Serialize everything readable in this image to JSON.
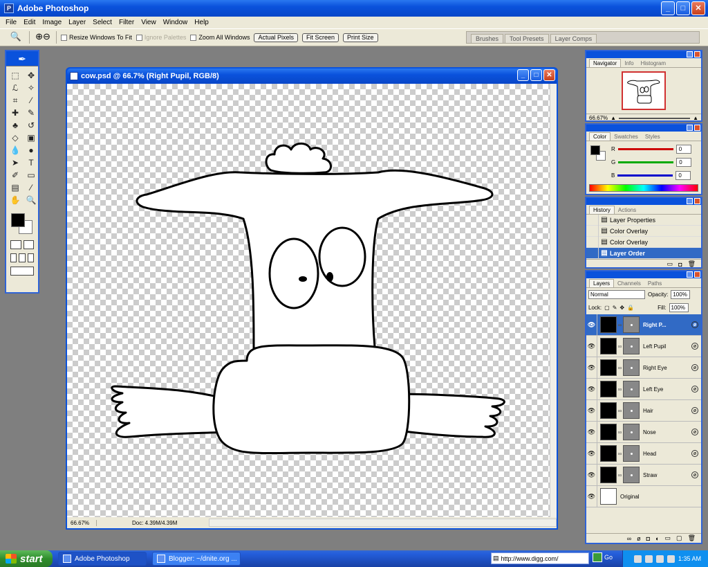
{
  "app": {
    "title": "Adobe Photoshop"
  },
  "window_buttons": {
    "minimize": "_",
    "maximize": "□",
    "close": "✕"
  },
  "menu": [
    "File",
    "Edit",
    "Image",
    "Layer",
    "Select",
    "Filter",
    "View",
    "Window",
    "Help"
  ],
  "options_bar": {
    "resize_windows": "Resize Windows To Fit",
    "ignore_palettes": "Ignore Palettes",
    "zoom_all": "Zoom All Windows",
    "actual_pixels": "Actual Pixels",
    "fit_screen": "Fit Screen",
    "print_size": "Print Size",
    "palette_well": [
      "Brushes",
      "Tool Presets",
      "Layer Comps"
    ]
  },
  "document": {
    "title": "cow.psd @ 66.7% (Right Pupil, RGB/8)",
    "status_zoom": "66.67%",
    "status_doc": "Doc: 4.39M/4.39M"
  },
  "navigator": {
    "tabs": [
      "Navigator",
      "Info",
      "Histogram"
    ],
    "zoom": "66.67%"
  },
  "color": {
    "tabs": [
      "Color",
      "Swatches",
      "Styles"
    ],
    "r_label": "R",
    "g_label": "G",
    "b_label": "B",
    "r": "0",
    "g": "0",
    "b": "0"
  },
  "history": {
    "tabs": [
      "History",
      "Actions"
    ],
    "items": [
      "Layer Properties",
      "Color Overlay",
      "Color Overlay",
      "Layer Order"
    ]
  },
  "layers": {
    "tabs": [
      "Layers",
      "Channels",
      "Paths"
    ],
    "blend_mode": "Normal",
    "opacity_label": "Opacity:",
    "opacity": "100%",
    "lock_label": "Lock:",
    "fill_label": "Fill:",
    "fill": "100%",
    "items": [
      "Right P...",
      "Left Pupil",
      "Right Eye",
      "Left Eye",
      "Hair",
      "Nose",
      "Head",
      "Straw",
      "Original"
    ]
  },
  "taskbar": {
    "start": "start",
    "items": [
      "Adobe Photoshop",
      "Blogger: ~/dnite.org ..."
    ],
    "address": "http://www.digg.com/",
    "go": "Go",
    "time": "1:35 AM"
  },
  "colors": {
    "xp_blue": "#0a52dc",
    "selection": "#316ac5",
    "panel_bg": "#ece9d8"
  }
}
